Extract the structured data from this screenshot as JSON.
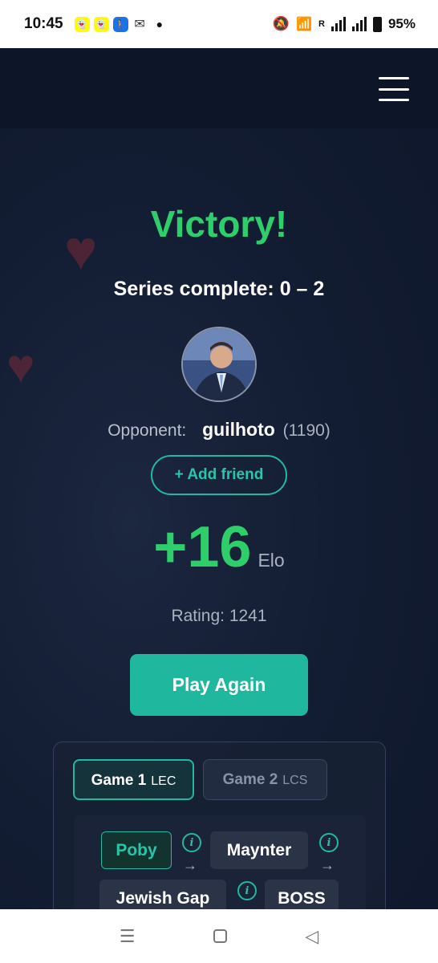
{
  "status_bar": {
    "time": "10:45",
    "battery": "95%",
    "network_label": "R",
    "icons": [
      "snapchat-icon",
      "snapchat-icon",
      "walking-icon",
      "gmail-icon",
      "app-icon",
      "dot-icon",
      "mute-icon",
      "wifi-icon",
      "signal-icon",
      "signal-icon",
      "battery-icon"
    ]
  },
  "result": {
    "title": "Victory!",
    "series": "Series complete: 0 – 2"
  },
  "opponent": {
    "label": "Opponent:",
    "name": "guilhoto",
    "rating": "(1190)",
    "add_friend_label": "+ Add friend"
  },
  "elo": {
    "change": "+16",
    "unit": "Elo",
    "rating_text": "Rating: 1241"
  },
  "play_again_label": "Play Again",
  "games": {
    "tabs": [
      {
        "label": "Game 1",
        "league": "LEC",
        "active": true
      },
      {
        "label": "Game 2",
        "league": "LCS",
        "active": false
      }
    ],
    "players": [
      "Poby",
      "Maynter",
      "Jewish Gap",
      "BOSS"
    ],
    "info_glyph": "i",
    "arrow_glyph": "→"
  },
  "colors": {
    "accent": "#1fb89e",
    "victory": "#2ecf6b",
    "background": "#0f1a2e"
  }
}
